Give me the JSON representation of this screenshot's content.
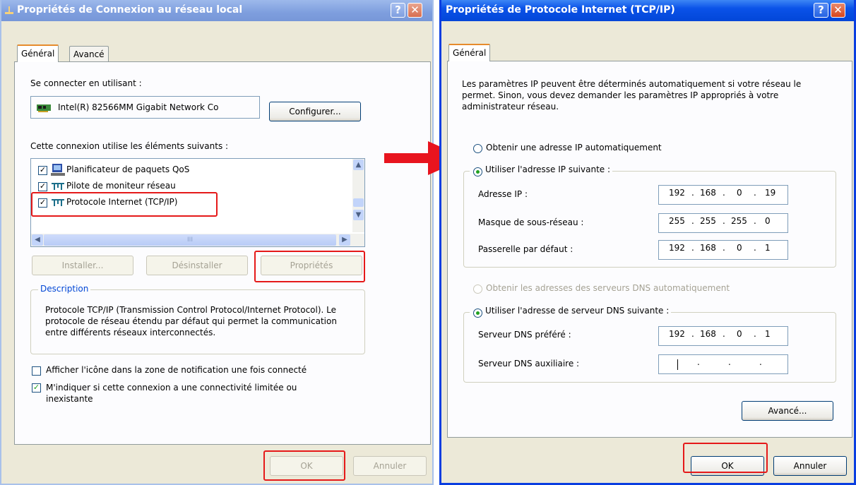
{
  "left_window": {
    "title": "Propriétés de Connexion au réseau local",
    "help_glyph": "?",
    "close_glyph": "✕",
    "tabs": [
      {
        "label": "Général"
      },
      {
        "label": "Avancé"
      }
    ],
    "connect_using_label": "Se connecter en utilisant :",
    "adapter_name": "Intel(R) 82566MM Gigabit Network Co",
    "configure_button": "Configurer...",
    "components_label": "Cette connexion utilise les éléments suivants :",
    "components": [
      {
        "label": "Planificateur de paquets QoS",
        "checked": true
      },
      {
        "label": "Pilote de moniteur réseau",
        "checked": true
      },
      {
        "label": "Protocole Internet (TCP/IP)",
        "checked": true
      }
    ],
    "check_glyph": "✓",
    "scroll_grip": "III",
    "install_button": "Installer...",
    "uninstall_button": "Désinstaller",
    "properties_button": "Propriétés",
    "description_legend": "Description",
    "description_text": "Protocole TCP/IP (Transmission Control Protocol/Internet Protocol). Le protocole de réseau étendu par défaut qui permet la communication entre différents réseaux interconnectés.",
    "show_icon_label": "Afficher l'icône dans la zone de notification une fois connecté",
    "show_icon_checked": false,
    "notify_limited_label": "M'indiquer si cette connexion a une connectivité limitée ou inexistante",
    "notify_limited_checked": true,
    "ok_button": "OK",
    "cancel_button": "Annuler"
  },
  "right_window": {
    "title": "Propriétés de Protocole Internet (TCP/IP)",
    "help_glyph": "?",
    "close_glyph": "✕",
    "tab": "Général",
    "intro": "Les paramètres IP peuvent être déterminés automatiquement si votre réseau le permet. Sinon, vous devez demander les paramètres IP appropriés à votre administrateur réseau.",
    "auto_ip_label": "Obtenir une adresse IP automatiquement",
    "manual_ip_label": "Utiliser l'adresse IP suivante :",
    "ip_label": "Adresse IP :",
    "ip_value": [
      "192",
      "168",
      "0",
      "19"
    ],
    "mask_label": "Masque de sous-réseau :",
    "mask_value": [
      "255",
      "255",
      "255",
      "0"
    ],
    "gateway_label": "Passerelle par défaut :",
    "gateway_value": [
      "192",
      "168",
      "0",
      "1"
    ],
    "auto_dns_label": "Obtenir les adresses des serveurs DNS automatiquement",
    "manual_dns_label": "Utiliser l'adresse de serveur DNS suivante :",
    "dns_pref_label": "Serveur DNS préféré :",
    "dns_pref_value": [
      "192",
      "168",
      "0",
      "1"
    ],
    "dns_alt_label": "Serveur DNS auxiliaire :",
    "dns_alt_value": [
      "",
      "",
      "",
      ""
    ],
    "dot": ".",
    "advanced_button": "Avancé...",
    "ok_button": "OK",
    "cancel_button": "Annuler"
  },
  "colors": {
    "highlight_red": "#e51919",
    "xp_blue": "#0a52e8",
    "dialog_bg": "#ece9d8",
    "arrow_red": "#e8141e"
  }
}
